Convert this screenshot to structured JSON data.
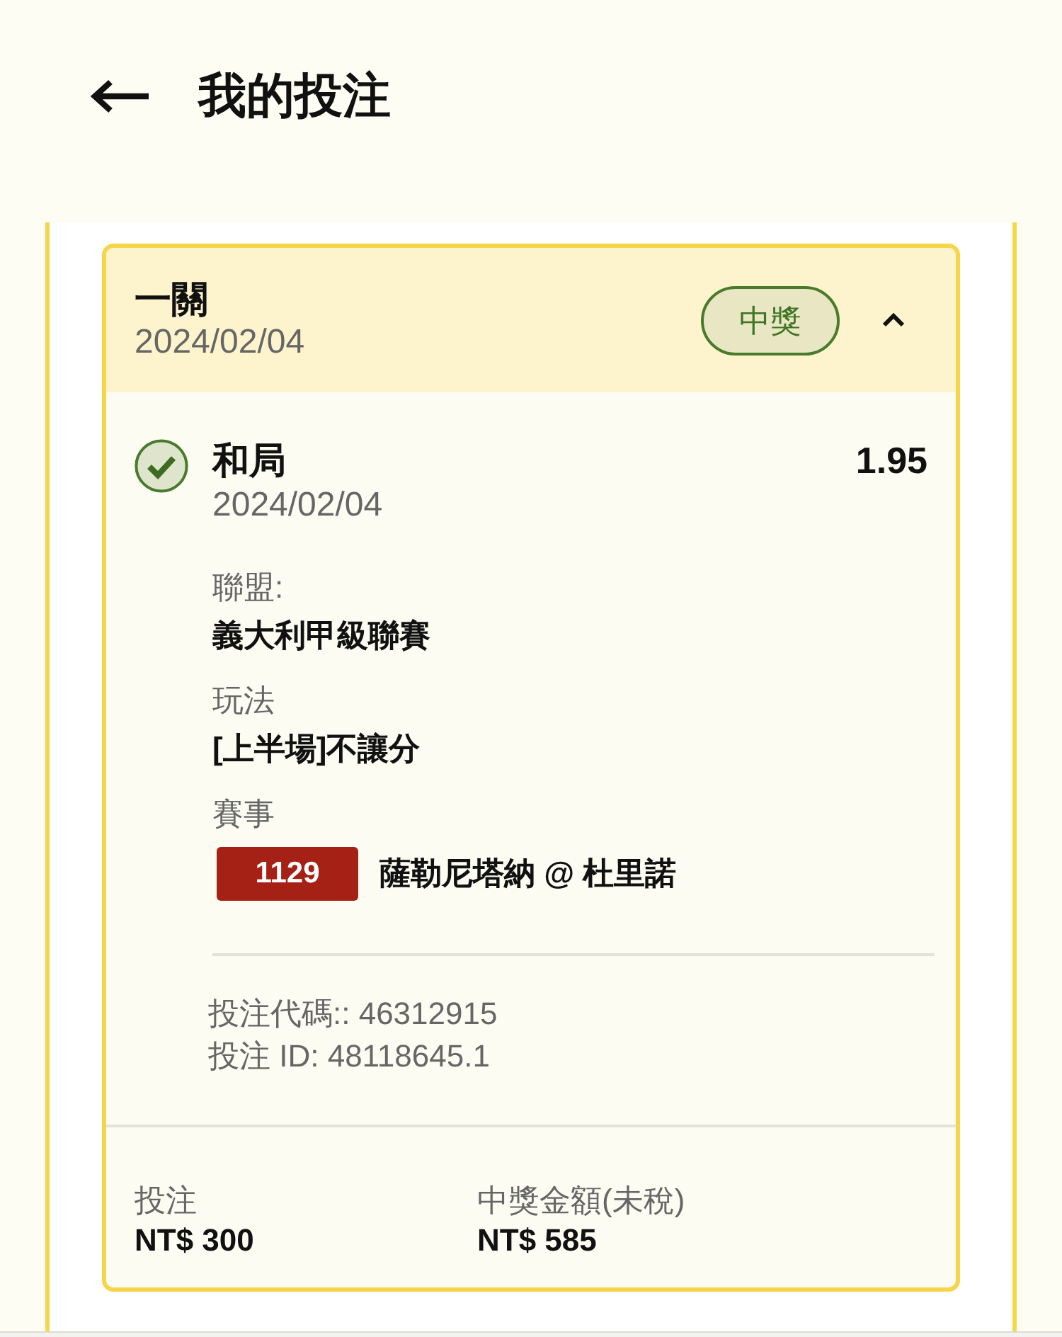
{
  "header": {
    "title": "我的投注"
  },
  "bets": [
    {
      "type": "一關",
      "date": "2024/02/04",
      "status": {
        "label": "中獎",
        "kind": "won"
      },
      "expanded": true,
      "selections": [
        {
          "won": true,
          "pick": "和局",
          "date": "2024/02/04",
          "odds": "1.95",
          "fields": [
            {
              "label": "聯盟:",
              "value": "義大利甲級聯賽"
            },
            {
              "label": "玩法",
              "value": "[上半場]不讓分"
            }
          ],
          "event": {
            "label": "賽事",
            "code": "1129",
            "match": "薩勒尼塔納 @ 杜里諾"
          }
        }
      ],
      "refs": [
        "投注代碼:: 46312915",
        "投注 ID: 48118645.1"
      ],
      "summary": [
        {
          "label": "投注",
          "value": "NT$ 300"
        },
        {
          "label": "中獎金額(未稅)",
          "value": "NT$ 585"
        }
      ]
    }
  ]
}
